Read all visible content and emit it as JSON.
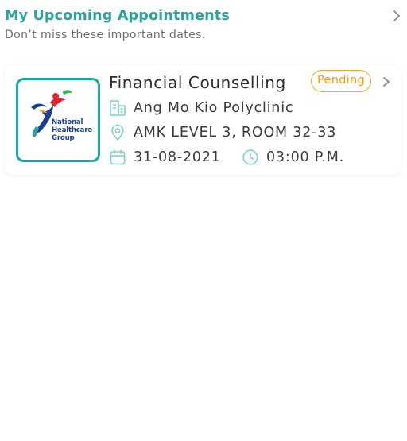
{
  "header": {
    "title": "My Upcoming Appointments",
    "subtitle": "Don’t miss these important dates.",
    "chevron_icon": "chevron-right-icon"
  },
  "appointment": {
    "logo": {
      "lines": [
        "National",
        "Healthcare",
        "Group"
      ],
      "border_color": "#1fa8a6"
    },
    "title": "Financial Counselling",
    "status": "Pending",
    "status_color": "#f5a623",
    "clinic": "Ang Mo Kio Polyclinic",
    "location": "AMK LEVEL 3, ROOM 32-33",
    "date": "31-08-2021",
    "time": "03:00 P.M.",
    "icons": {
      "clinic": "building-icon",
      "location": "location-pin-icon",
      "date": "calendar-icon",
      "time": "clock-icon"
    }
  },
  "colors": {
    "accent": "#2aa3a0",
    "icon": "#7fd1cc"
  }
}
